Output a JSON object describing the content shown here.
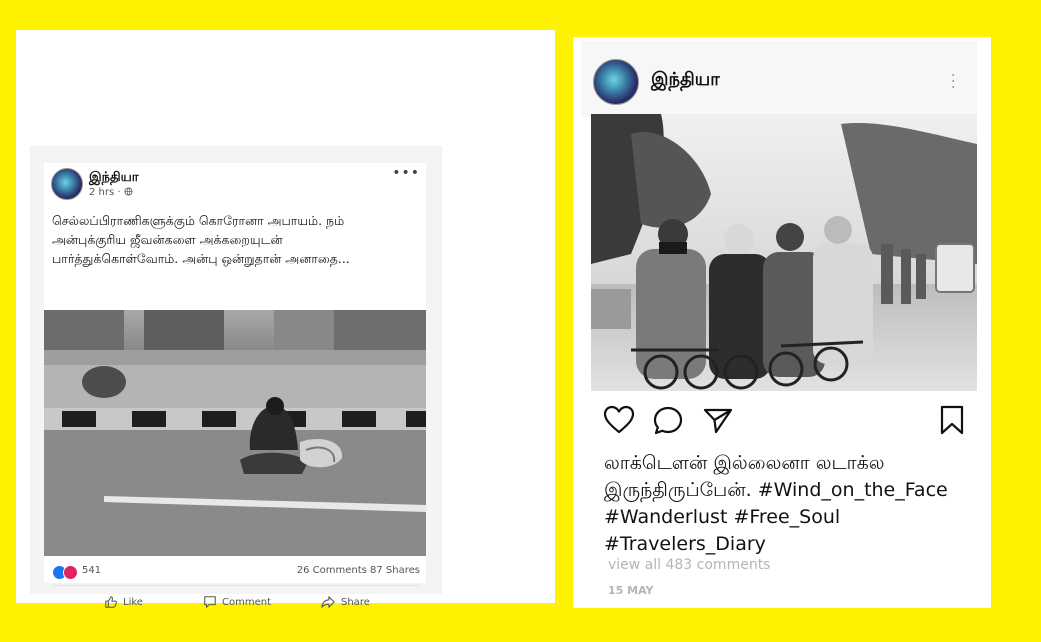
{
  "colors": {
    "background": "#FFF200",
    "love_react": "#e0245e",
    "like_react": "#1877f2"
  },
  "facebook_post": {
    "author": "இந்தியா",
    "time": "2 hrs · ",
    "privacy_icon": "globe-icon",
    "more_icon": "more-dots-icon",
    "text": "செல்லப்பிராணிகளுக்கும் கொரோனா அபாயம். நம் அன்புக்குரிய ஜீவன்களை அக்கறையுடன் பார்த்துக்கொள்வோம். அன்பு ஒன்றுதான் அனாதை...",
    "reactions_count": "541",
    "comments_shares": "26 Comments  87 Shares",
    "actions": {
      "like": "Like",
      "comment": "Comment",
      "share": "Share"
    }
  },
  "instagram_post": {
    "author": "இந்தியா",
    "more_icon": "vertical-dots-icon",
    "action_icons": [
      "heart-icon",
      "comment-bubble-icon",
      "send-icon",
      "bookmark-icon"
    ],
    "caption_lines": [
      "லாக்டௌன் இல்லைனா லடாக்ல",
      "இருந்திருப்பேன். #Wind_on_the_Face",
      "#Wanderlust  #Free_Soul",
      "#Travelers_Diary"
    ],
    "view_comments": "view all 483 comments",
    "date": "15 MAY"
  }
}
